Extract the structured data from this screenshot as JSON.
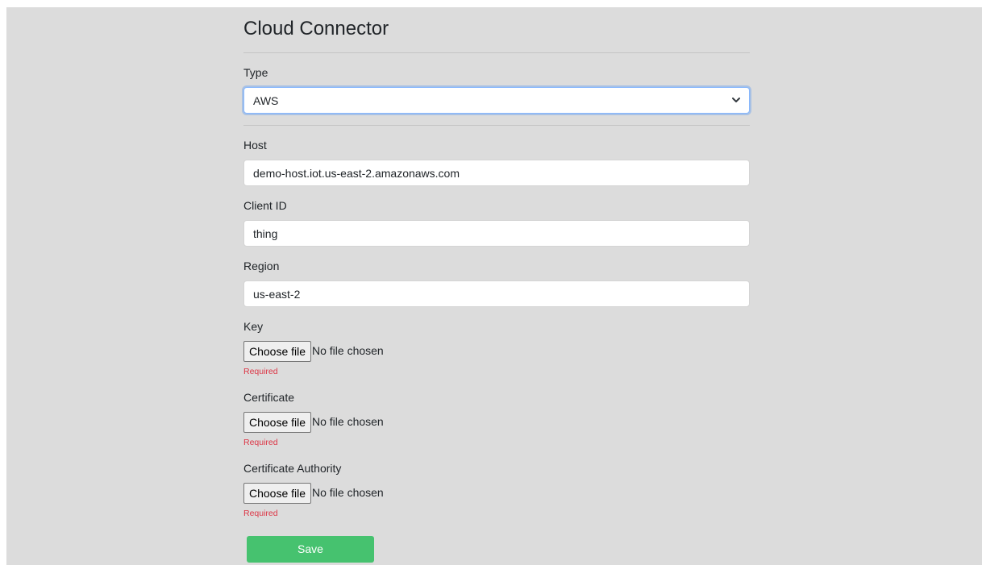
{
  "page": {
    "title": "Cloud Connector"
  },
  "type_field": {
    "label": "Type",
    "selected": "AWS"
  },
  "host_field": {
    "label": "Host",
    "value": "demo-host.iot.us-east-2.amazonaws.com"
  },
  "client_id_field": {
    "label": "Client ID",
    "value": "thing"
  },
  "region_field": {
    "label": "Region",
    "value": "us-east-2"
  },
  "key_field": {
    "label": "Key",
    "button": "Choose file",
    "status": "No file chosen",
    "validation": "Required"
  },
  "certificate_field": {
    "label": "Certificate",
    "button": "Choose file",
    "status": "No file chosen",
    "validation": "Required"
  },
  "ca_field": {
    "label": "Certificate Authority",
    "button": "Choose file",
    "status": "No file chosen",
    "validation": "Required"
  },
  "actions": {
    "save_label": "Save"
  },
  "colors": {
    "background": "#dcdcdc",
    "focus_border": "#86b7fe",
    "required_text": "#dc3545",
    "save_button": "#46c26f"
  },
  "icons": {
    "select_chevron": "chevron-down-icon"
  }
}
